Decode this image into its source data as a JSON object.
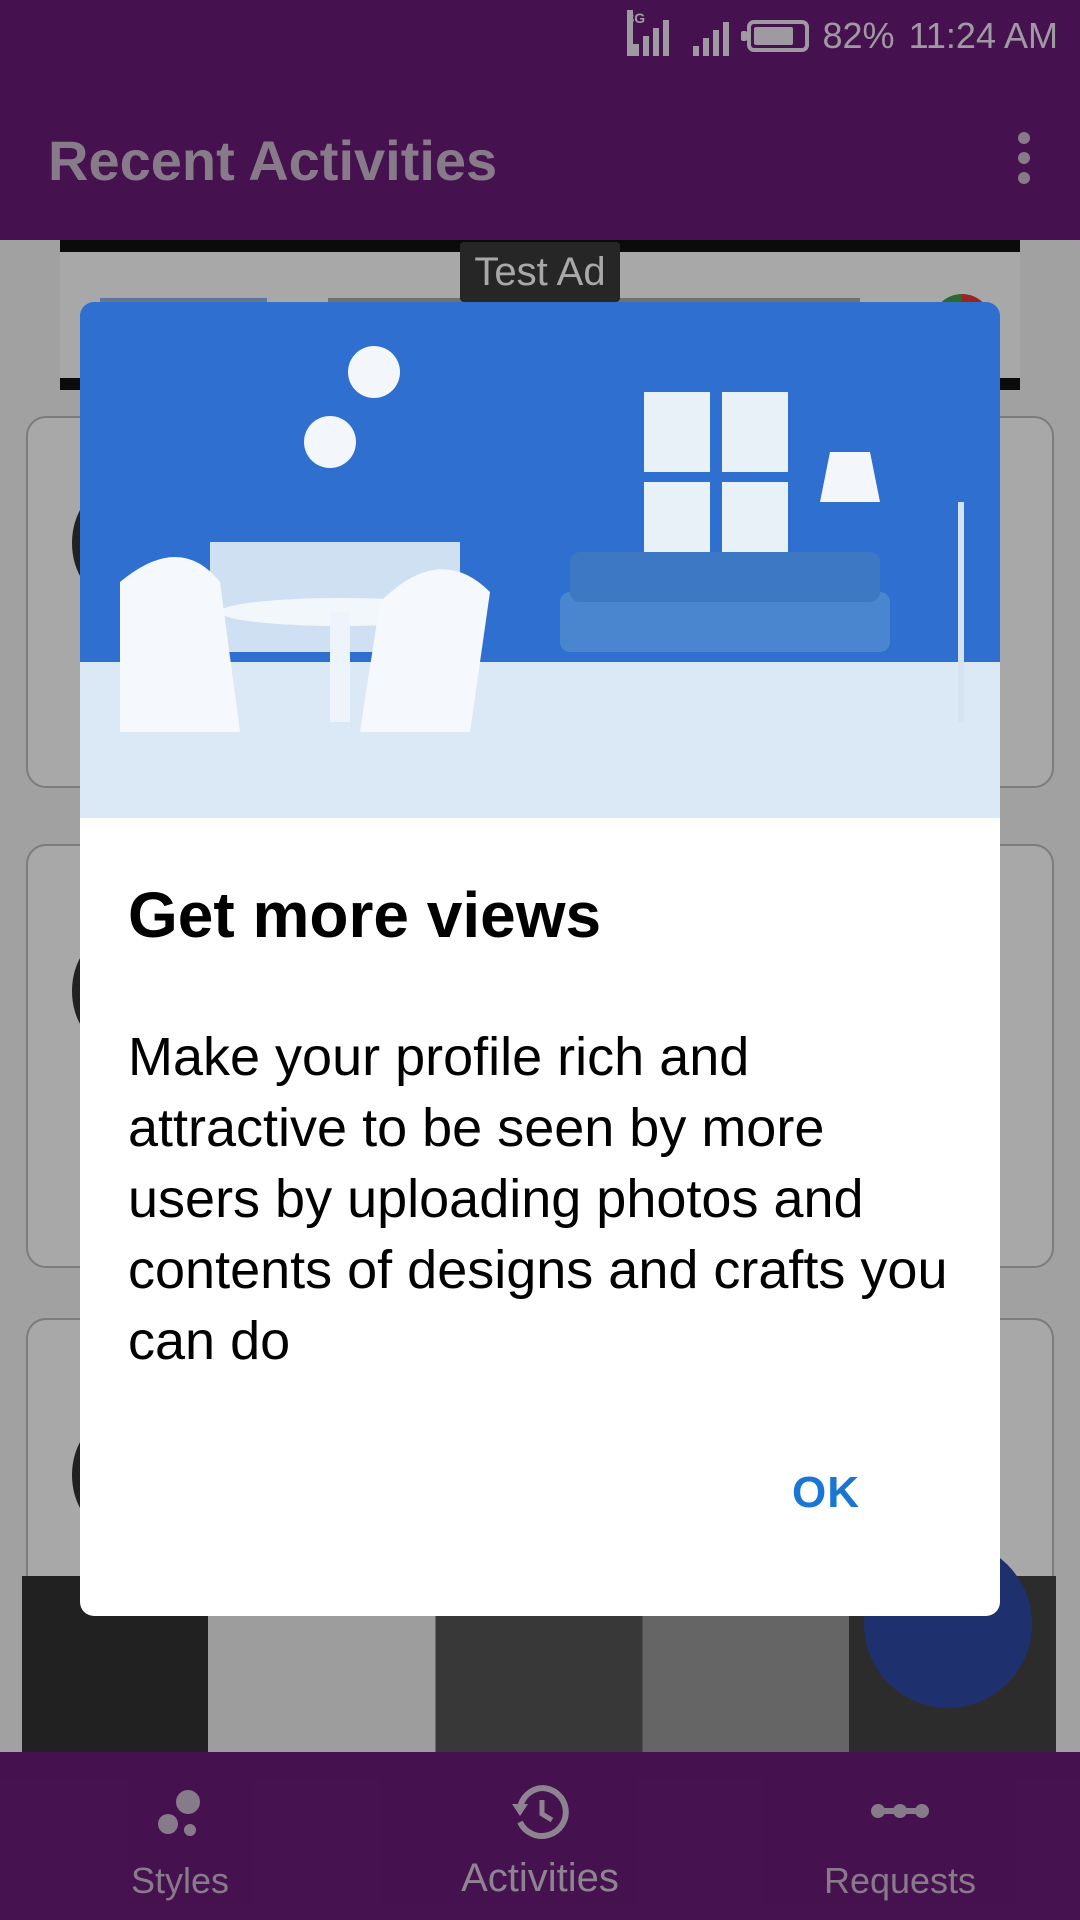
{
  "status_bar": {
    "network": "3G",
    "battery_percent": "82%",
    "time": "11:24 AM",
    "battery_level": 0.82
  },
  "app_bar": {
    "title": "Recent Activities"
  },
  "ad": {
    "label": "Test Ad"
  },
  "dialog": {
    "title": "Get more views",
    "message": "Make your profile rich and attractive to be seen by more users by uploading photos and contents of designs and crafts you can do",
    "ok_label": "OK"
  },
  "bottom_nav": {
    "items": [
      {
        "label": "Styles",
        "icon": "styles-icon"
      },
      {
        "label": "Activities",
        "icon": "history-icon"
      },
      {
        "label": "Requests",
        "icon": "requests-icon"
      }
    ],
    "active": "Activities"
  },
  "colors": {
    "primary": "#6a1b78",
    "accent": "#1976d2",
    "fab": "#2f4aa8"
  }
}
